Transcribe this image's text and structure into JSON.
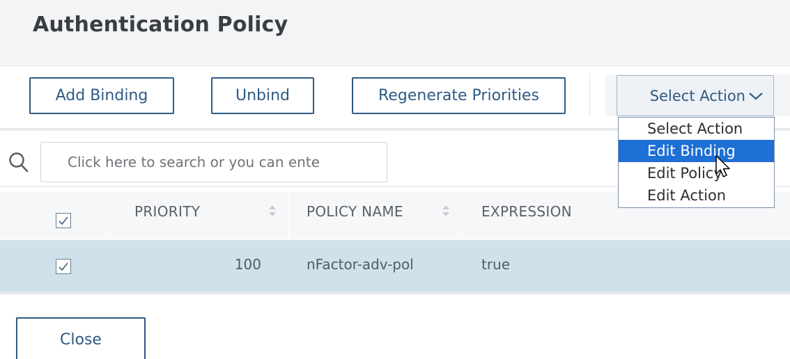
{
  "header": {
    "title": "Authentication Policy"
  },
  "toolbar": {
    "add_binding": "Add Binding",
    "unbind": "Unbind",
    "regenerate": "Regenerate Priorities",
    "select_action": "Select Action"
  },
  "dropdown": {
    "items": [
      "Select Action",
      "Edit Binding",
      "Edit Policy",
      "Edit Action"
    ],
    "highlighted": "Edit Binding"
  },
  "search": {
    "placeholder": "Click here to search or you can ente"
  },
  "table": {
    "columns": [
      "PRIORITY",
      "POLICY NAME",
      "EXPRESSION"
    ],
    "header_checked": true,
    "rows": [
      {
        "checked": true,
        "priority": "100",
        "policy_name": "nFactor-adv-pol",
        "expression": "true"
      }
    ]
  },
  "footer": {
    "close": "Close"
  },
  "colors": {
    "accent": "#2e5a84",
    "selected_row": "#cfe2ec",
    "dropdown_highlight": "#1e6fd6"
  }
}
